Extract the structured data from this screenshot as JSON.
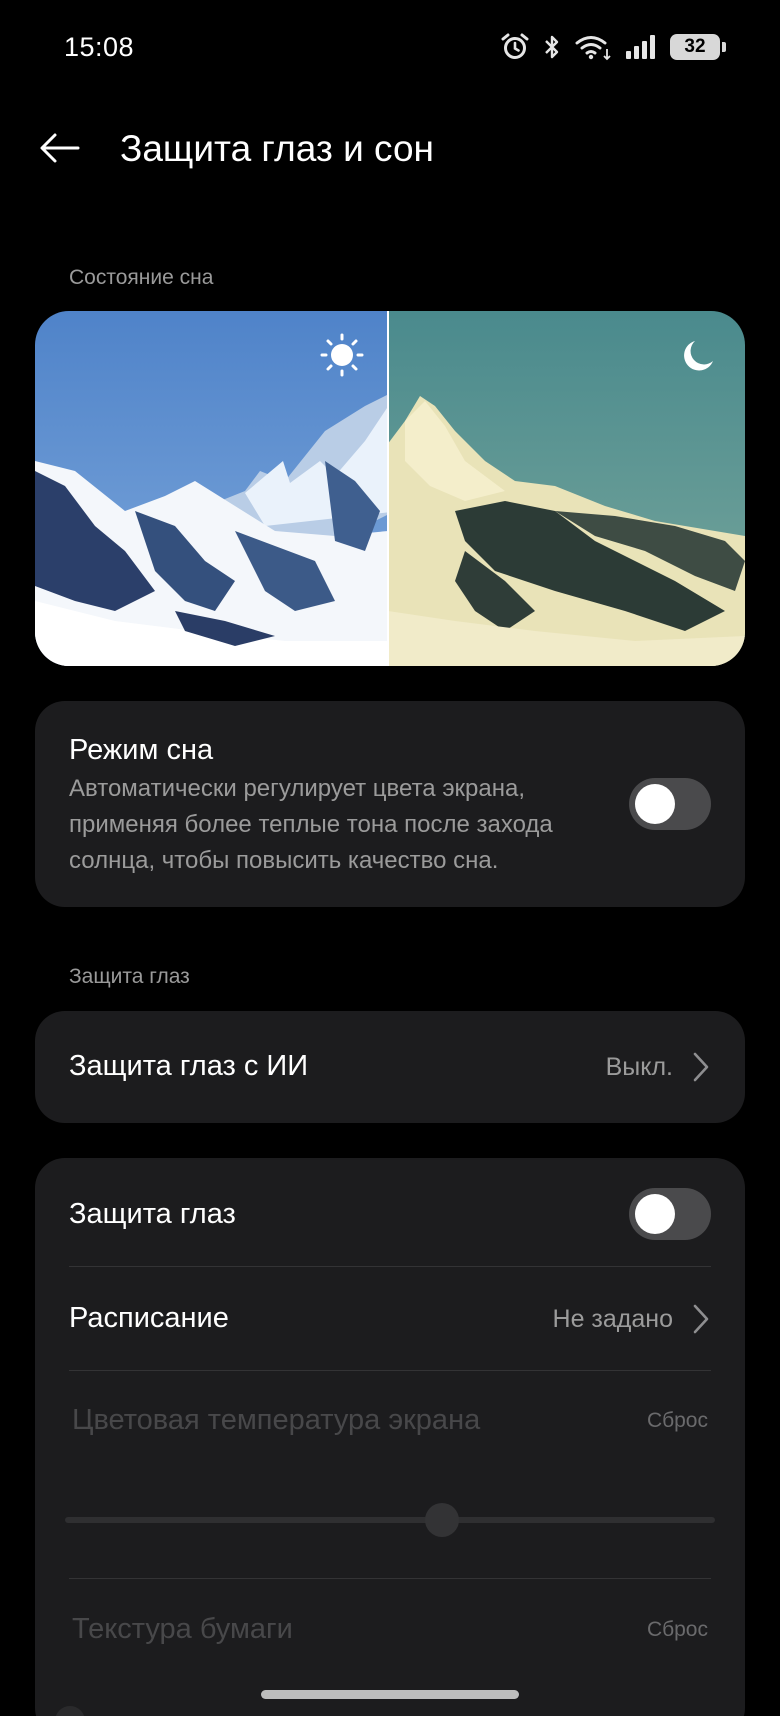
{
  "status_bar": {
    "time": "15:08",
    "battery": "32",
    "icons": [
      "alarm-icon",
      "bluetooth-icon",
      "wifi-icon",
      "signal-icon",
      "battery-icon"
    ]
  },
  "header": {
    "title": "Защита глаз и сон",
    "back_icon": "arrow-left-icon"
  },
  "sleep_section": {
    "label": "Состояние сна",
    "preview": {
      "day_icon": "sun-icon",
      "night_icon": "moon-icon"
    },
    "sleep_mode": {
      "title": "Режим сна",
      "description": "Автоматически регулирует цвета экрана, применяя более теплые тона после захода солнца, чтобы повысить качество сна.",
      "enabled": false
    }
  },
  "eye_section": {
    "label": "Защита глаз",
    "ai_eye_care": {
      "title": "Защита глаз с ИИ",
      "value": "Выкл."
    },
    "eye_care": {
      "title": "Защита глаз",
      "enabled": false
    },
    "schedule": {
      "title": "Расписание",
      "value": "Не задано"
    },
    "color_temperature": {
      "title": "Цветовая температура экрана",
      "reset": "Сброс",
      "level": 0.58
    },
    "paper_texture": {
      "title": "Текстура бумаги",
      "reset": "Сброс"
    }
  },
  "colors": {
    "background": "#000000",
    "card": "#1c1c1e",
    "toggle_off": "#4a4a4c",
    "secondary_text": "#9b9b9b",
    "disabled_text": "#48484a"
  }
}
